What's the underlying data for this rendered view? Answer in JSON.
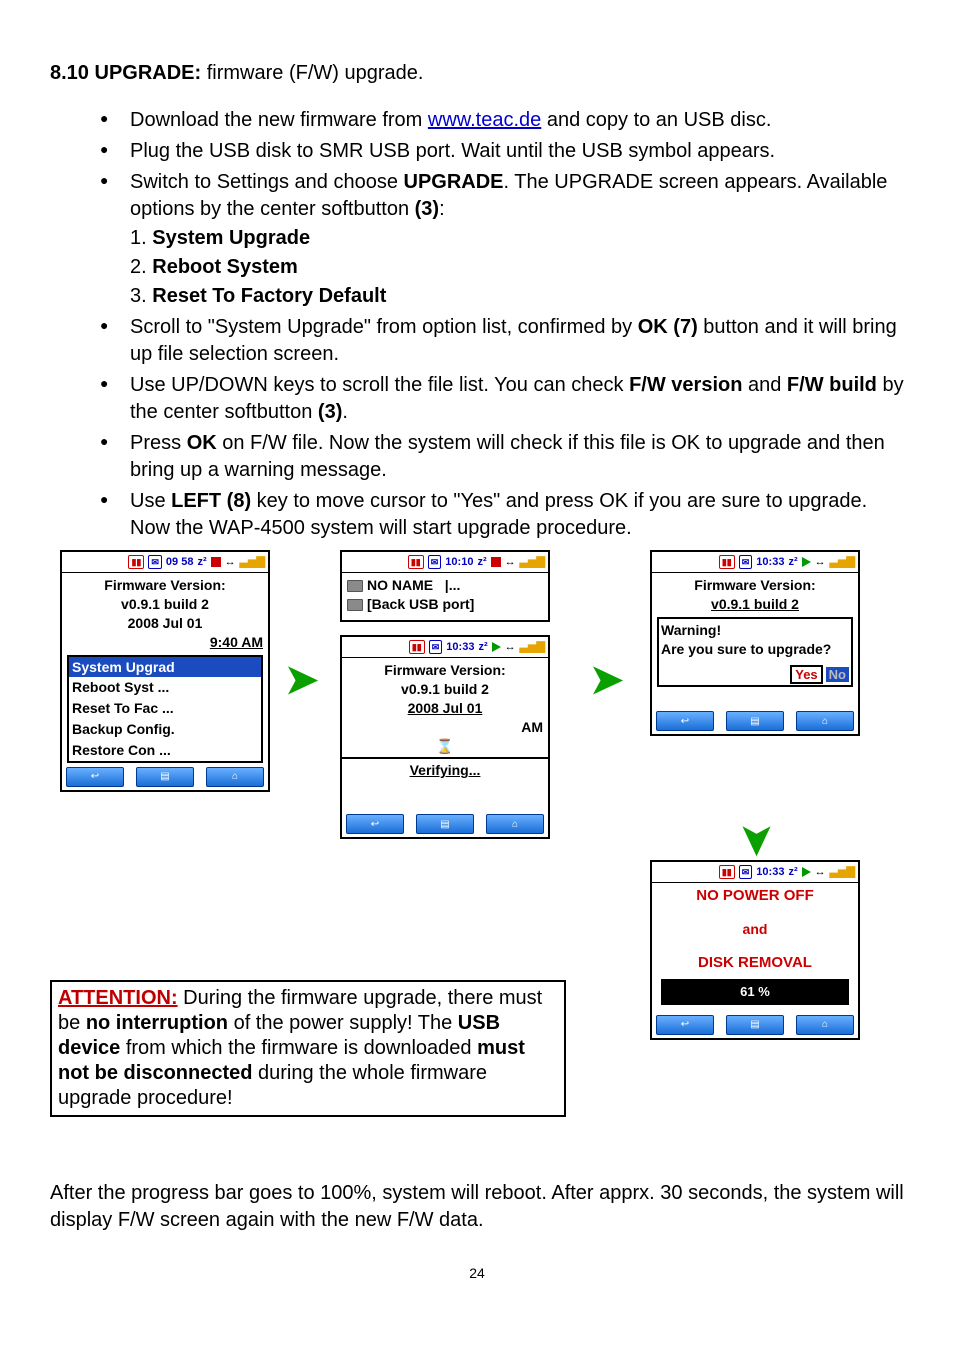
{
  "section": {
    "number": "8.10",
    "title_bold": "UPGRADE:",
    "title_rest": " firmware (F/W) upgrade."
  },
  "bullets": {
    "b1_pre": "Download the new firmware from ",
    "b1_link": "www.teac.de",
    "b1_post": " and copy to an USB disc.",
    "b2": "Plug the USB disk to SMR USB port. Wait until the USB symbol appears.",
    "b3_pre": "Switch to Settings and choose ",
    "b3_bold": "UPGRADE",
    "b3_mid": ". The UPGRADE screen appears. Available options by the center softbutton ",
    "b3_bold2": "(3)",
    "b3_post": ":",
    "opt1_num": "1. ",
    "opt1": "System Upgrade",
    "opt2_num": "2. ",
    "opt2": "Reboot System",
    "opt3_num": "3. ",
    "opt3": "Reset To Factory Default",
    "b4_pre": "Scroll to \"System Upgrade\" from option list, confirmed by ",
    "b4_bold": "OK (7)",
    "b4_post": " button and it will bring up file selection screen.",
    "b5_pre": "Use UP/DOWN keys to scroll the file list. You can check ",
    "b5_bold1": "F/W version",
    "b5_mid": " and ",
    "b5_bold2": "F/W build",
    "b5_mid2": " by the center softbutton ",
    "b5_bold3": "(3)",
    "b5_post": ".",
    "b6_pre": "Press ",
    "b6_bold": "OK",
    "b6_post": " on F/W file. Now the system will check if this file is OK to upgrade and then bring up a warning message.",
    "b7_pre": "Use ",
    "b7_bold": "LEFT (8)",
    "b7_post": " key to move cursor to \"Yes\" and press OK if you are sure to upgrade. Now the WAP-4500 system will start upgrade procedure."
  },
  "screen1": {
    "time": "09 58",
    "z": "z²",
    "title": "Firmware Version:",
    "ver": "v0.9.1 build 2",
    "date": "2008 Jul 01",
    "clock": "9:40 AM",
    "items": [
      "System Upgrad",
      "Reboot Syst ...",
      "Reset To Fac ...",
      "Backup Config.",
      "Restore Con ..."
    ]
  },
  "screen2": {
    "time": "10:10",
    "items": [
      "NO NAME",
      "[Back USB port]"
    ],
    "cursor": "|..."
  },
  "screen3": {
    "time": "10:33",
    "title": "Firmware Version:",
    "ver": "v0.9.1 build 2",
    "date": "2008 Jul 01",
    "clock": "AM",
    "status": "Verifying..."
  },
  "screen4": {
    "time": "10:33",
    "title": "Firmware Version:",
    "ver": "v0.9.1 build 2",
    "warn": "Warning!",
    "q": "Are you sure to upgrade?",
    "yes": "Yes",
    "no": "No"
  },
  "screen5": {
    "time": "10:33",
    "line1": "NO POWER OFF",
    "line2": "and",
    "line3": "DISK REMOVAL",
    "progress": "61 %"
  },
  "attention": {
    "label": "ATTENTION:",
    "t1": " During the firmware upgrade, there must be ",
    "t2": "no interruption",
    "t3": " of the power supply! The ",
    "t4": "USB device",
    "t5": " from which the firmware is downloaded ",
    "t6": "must not be disconnected",
    "t7": " during the whole firmware upgrade procedure!"
  },
  "after_text": "After the progress bar goes to 100%, system will reboot. After apprx. 30 seconds, the system will display F/W screen again with the new F/W data.",
  "page_num": "24",
  "icons": {
    "back": "↩",
    "list": "▤",
    "home": "⌂",
    "arrows": "↔",
    "sig": "▃▅▇"
  }
}
